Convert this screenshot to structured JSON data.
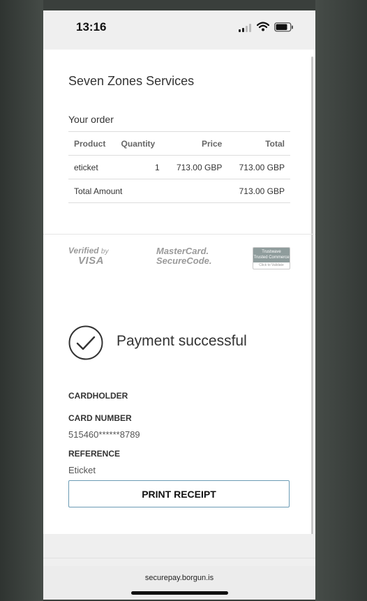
{
  "status_bar": {
    "time": "13:16"
  },
  "merchant": {
    "name": "Seven Zones Services"
  },
  "order": {
    "title": "Your order",
    "columns": {
      "product": "Product",
      "quantity": "Quantity",
      "price": "Price",
      "total": "Total"
    },
    "rows": [
      {
        "product": "eticket",
        "quantity": "1",
        "price": "713.00 GBP",
        "total": "713.00 GBP"
      }
    ],
    "total_label": "Total Amount",
    "total_value": "713.00 GBP"
  },
  "security_logos": {
    "visa": {
      "line1": "Verified",
      "by": "by",
      "line2": "VISA"
    },
    "mastercard": {
      "line1": "MasterCard.",
      "line2": "SecureCode."
    },
    "trustwave": {
      "name": "Trustwave",
      "sub": "Trusted Commerce",
      "action": "Click to Validate"
    }
  },
  "payment": {
    "message": "Payment successful"
  },
  "details": {
    "cardholder_label": "CARDHOLDER",
    "card_number_label": "CARD NUMBER",
    "card_number_value": "515460******8789",
    "reference_label": "REFERENCE",
    "reference_value": "Eticket"
  },
  "print_button": {
    "label": "PRINT RECEIPT"
  },
  "browser": {
    "url": "securepay.borgun.is"
  },
  "colors": {
    "button_border": "#6b9bb4",
    "accent_gray": "#9a9a9a"
  },
  "icons": [
    "signal-icon",
    "wifi-icon",
    "battery-icon",
    "checkmark-circle-icon"
  ]
}
